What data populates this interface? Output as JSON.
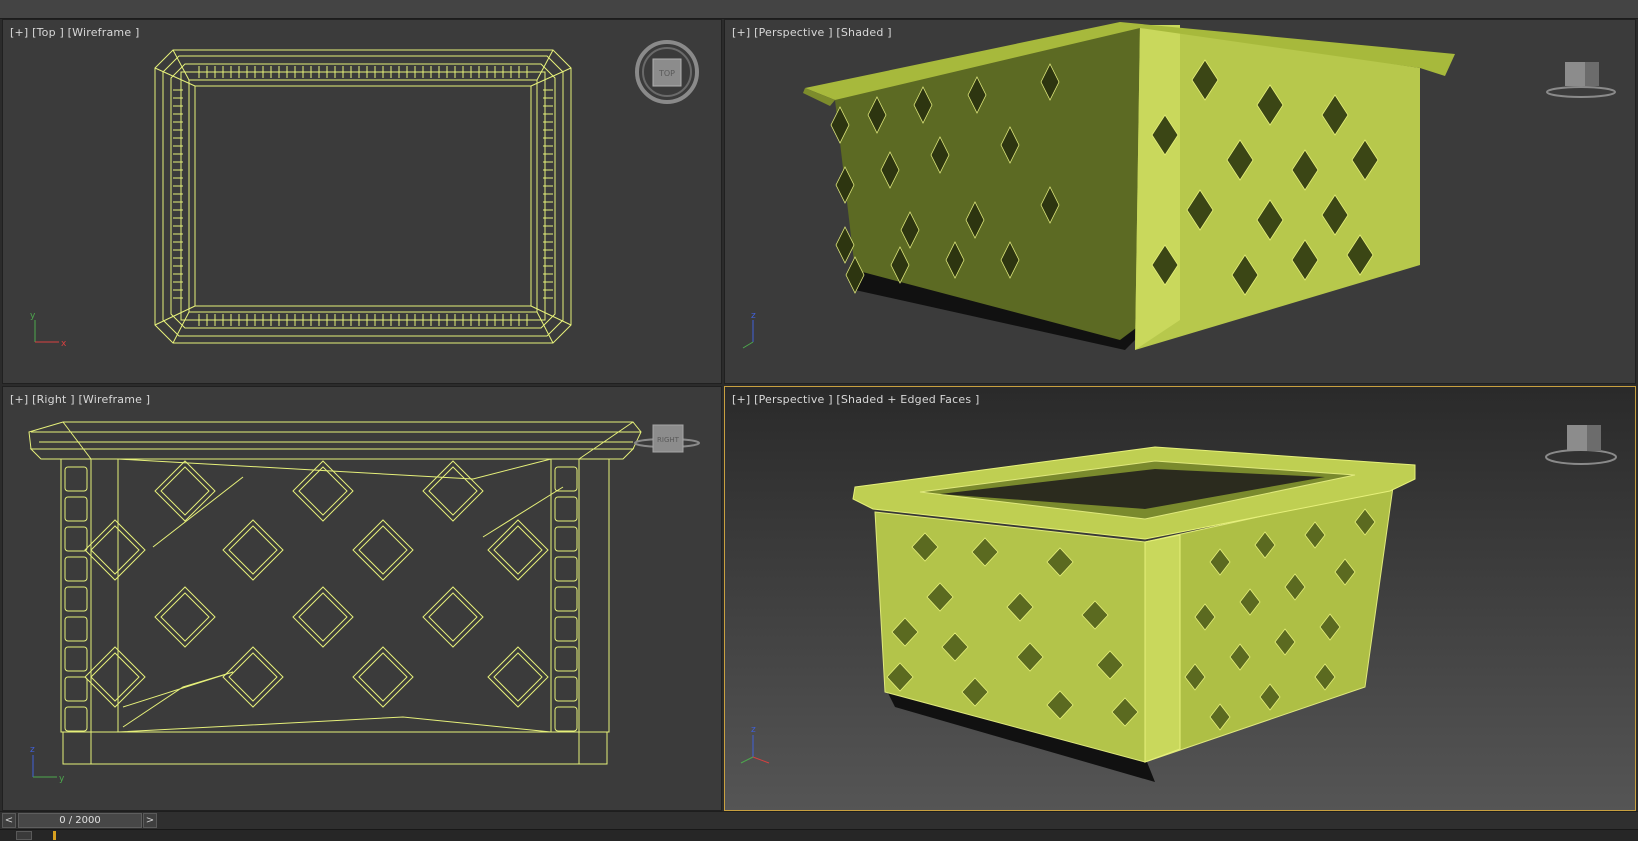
{
  "viewports": [
    {
      "label": "[+] [Top ] [Wireframe ]",
      "viewcube": "TOP"
    },
    {
      "label": "[+] [Perspective ] [Shaded ]",
      "viewcube": ""
    },
    {
      "label": "[+] [Right ] [Wireframe ]",
      "viewcube": "RIGHT"
    },
    {
      "label": "[+] [Perspective ] [Shaded + Edged Faces ]",
      "viewcube": ""
    }
  ],
  "axes": {
    "x": "x",
    "y": "y",
    "z": "z"
  },
  "timeline": {
    "frame": "0 / 2000",
    "prev": "<",
    "next": ">"
  },
  "colors": {
    "model": "#b8c84a",
    "wire": "#e6f07a",
    "active": "#c8a040"
  }
}
